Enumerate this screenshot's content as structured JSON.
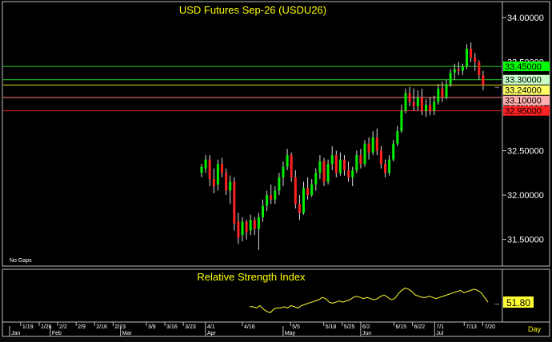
{
  "chart_data": [
    {
      "type": "candlestick",
      "title": "USD Futures Sep-26 (USDU26)",
      "note": "No Gaps",
      "ylim": [
        31.2,
        34.18
      ],
      "y_ticks": [
        "34.00000",
        "33.50000",
        "33.00000",
        "32.50000",
        "32.00000",
        "31.50000"
      ],
      "y_tick_values": [
        34.0,
        33.5,
        33.0,
        32.5,
        32.0,
        31.5
      ],
      "levels": [
        {
          "label": "33.45000",
          "value": 33.45,
          "color": "#22cc22",
          "box": "#00ff00",
          "text": "#000000"
        },
        {
          "label": "33.30000",
          "value": 33.3,
          "color": "#22cc22",
          "box": "#c8ffc8",
          "text": "#000000"
        },
        {
          "label": "33.24000",
          "value": 33.24,
          "color": "#dddd00",
          "box": "#ffff66",
          "text": "#000000"
        },
        {
          "label": "33.10000",
          "value": 33.1,
          "color": "#ff8080",
          "box": "#ffb0b0",
          "text": "#000000"
        },
        {
          "label": "32.95000",
          "value": 32.95,
          "color": "#dd2222",
          "box": "#ff2222",
          "text": "#000000"
        }
      ],
      "candles": [
        [
          32.25,
          32.35,
          32.2,
          32.32
        ],
        [
          32.3,
          32.45,
          32.25,
          32.4
        ],
        [
          32.4,
          32.45,
          32.1,
          32.18
        ],
        [
          32.18,
          32.3,
          32.02,
          32.1
        ],
        [
          32.12,
          32.4,
          32.05,
          32.35
        ],
        [
          32.35,
          32.42,
          32.2,
          32.25
        ],
        [
          32.25,
          32.3,
          32.0,
          32.05
        ],
        [
          32.05,
          32.22,
          31.9,
          32.15
        ],
        [
          32.15,
          32.2,
          31.6,
          31.68
        ],
        [
          31.7,
          31.8,
          31.45,
          31.52
        ],
        [
          31.55,
          31.75,
          31.48,
          31.7
        ],
        [
          31.7,
          31.72,
          31.5,
          31.58
        ],
        [
          31.6,
          31.78,
          31.55,
          31.72
        ],
        [
          31.72,
          31.75,
          31.55,
          31.62
        ],
        [
          31.62,
          31.8,
          31.38,
          31.75
        ],
        [
          31.75,
          31.95,
          31.7,
          31.88
        ],
        [
          31.88,
          32.05,
          31.82,
          32.0
        ],
        [
          32.0,
          32.12,
          31.9,
          31.95
        ],
        [
          31.95,
          32.1,
          31.9,
          32.05
        ],
        [
          32.05,
          32.25,
          32.0,
          32.2
        ],
        [
          32.2,
          32.38,
          32.1,
          32.32
        ],
        [
          32.32,
          32.52,
          32.28,
          32.45
        ],
        [
          32.45,
          32.48,
          32.15,
          32.2
        ],
        [
          32.2,
          32.28,
          31.85,
          31.9
        ],
        [
          31.9,
          32.0,
          31.72,
          31.8
        ],
        [
          31.8,
          32.15,
          31.78,
          32.08
        ],
        [
          32.08,
          32.2,
          31.95,
          32.0
        ],
        [
          32.0,
          32.18,
          31.98,
          32.12
        ],
        [
          32.12,
          32.3,
          32.05,
          32.25
        ],
        [
          32.25,
          32.45,
          32.18,
          32.38
        ],
        [
          32.38,
          32.42,
          32.1,
          32.15
        ],
        [
          32.15,
          32.4,
          32.12,
          32.35
        ],
        [
          32.35,
          32.55,
          32.28,
          32.45
        ],
        [
          32.45,
          32.5,
          32.2,
          32.25
        ],
        [
          32.25,
          32.48,
          32.22,
          32.4
        ],
        [
          32.4,
          32.45,
          32.22,
          32.28
        ],
        [
          32.28,
          32.38,
          32.15,
          32.2
        ],
        [
          32.2,
          32.32,
          32.1,
          32.28
        ],
        [
          32.28,
          32.5,
          32.25,
          32.45
        ],
        [
          32.45,
          32.52,
          32.3,
          32.35
        ],
        [
          32.35,
          32.62,
          32.32,
          32.58
        ],
        [
          32.58,
          32.65,
          32.4,
          32.48
        ],
        [
          32.48,
          32.72,
          32.45,
          32.65
        ],
        [
          32.65,
          32.75,
          32.45,
          32.5
        ],
        [
          32.5,
          32.55,
          32.3,
          32.35
        ],
        [
          32.35,
          32.4,
          32.2,
          32.25
        ],
        [
          32.25,
          32.45,
          32.22,
          32.4
        ],
        [
          32.4,
          32.62,
          32.38,
          32.58
        ],
        [
          32.58,
          32.78,
          32.55,
          32.72
        ],
        [
          32.72,
          33.02,
          32.7,
          32.95
        ],
        [
          32.95,
          33.2,
          32.92,
          33.15
        ],
        [
          33.15,
          33.22,
          33.0,
          33.05
        ],
        [
          33.05,
          33.2,
          32.95,
          33.0
        ],
        [
          33.0,
          33.18,
          32.95,
          33.1
        ],
        [
          33.1,
          33.2,
          32.9,
          32.95
        ],
        [
          32.95,
          33.08,
          32.88,
          33.02
        ],
        [
          33.02,
          33.1,
          32.9,
          32.95
        ],
        [
          32.95,
          33.12,
          32.9,
          33.05
        ],
        [
          33.05,
          33.25,
          33.02,
          33.2
        ],
        [
          33.2,
          33.28,
          33.05,
          33.1
        ],
        [
          33.1,
          33.3,
          33.08,
          33.25
        ],
        [
          33.25,
          33.42,
          33.22,
          33.38
        ],
        [
          33.38,
          33.48,
          33.3,
          33.42
        ],
        [
          33.42,
          33.5,
          33.35,
          33.4
        ],
        [
          33.4,
          33.48,
          33.35,
          33.45
        ],
        [
          33.45,
          33.7,
          33.42,
          33.65
        ],
        [
          33.65,
          33.72,
          33.5,
          33.55
        ],
        [
          33.55,
          33.6,
          33.4,
          33.5
        ],
        [
          33.5,
          33.52,
          33.3,
          33.35
        ],
        [
          33.35,
          33.4,
          33.18,
          33.24
        ]
      ],
      "x_ticks": [
        {
          "label": "1/19",
          "i": -47
        },
        {
          "label": "1/26",
          "i": -42
        },
        {
          "label": "2/2",
          "i": -37
        },
        {
          "label": "2/9",
          "i": -32
        },
        {
          "label": "2/16",
          "i": -27
        },
        {
          "label": "2/23",
          "i": -22
        },
        {
          "label": "3/9",
          "i": -13
        },
        {
          "label": "3/16",
          "i": -8
        },
        {
          "label": "3/23",
          "i": -3
        },
        {
          "label": "4/1",
          "i": 3
        },
        {
          "label": "4/16",
          "i": 13
        },
        {
          "label": "5/5",
          "i": 26
        },
        {
          "label": "5/18",
          "i": 35
        },
        {
          "label": "5/25",
          "i": 40
        },
        {
          "label": "6/2",
          "i": 45
        },
        {
          "label": "6/15",
          "i": 54
        },
        {
          "label": "6/22",
          "i": 59
        },
        {
          "label": "7/1",
          "i": 65
        },
        {
          "label": "7/13",
          "i": 73
        },
        {
          "label": "7/20",
          "i": 78
        }
      ],
      "months": [
        {
          "label": "Jan",
          "i": -50
        },
        {
          "label": "Feb",
          "i": -39
        },
        {
          "label": "Mar",
          "i": -20
        },
        {
          "label": "Apr",
          "i": 3
        },
        {
          "label": "May",
          "i": 24
        },
        {
          "label": "Jun",
          "i": 45
        },
        {
          "label": "Jul",
          "i": 65
        }
      ],
      "period_label": "Day"
    },
    {
      "type": "line",
      "title": "Relative Strength Index",
      "last_value": "51.80",
      "color": "#ffff33",
      "ylim": [
        35,
        80
      ],
      "values": [
        48,
        48,
        47,
        49,
        46,
        44,
        43,
        46,
        47,
        47,
        48,
        47,
        49,
        48,
        47,
        49,
        50,
        51,
        52,
        53,
        54,
        56,
        55,
        52,
        51,
        52,
        53,
        52,
        53,
        54,
        56,
        57,
        56,
        55,
        56,
        55,
        54,
        55,
        57,
        58,
        56,
        54,
        55,
        59,
        62,
        64,
        63,
        61,
        58,
        57,
        56,
        56,
        57,
        56,
        55,
        56,
        57,
        58,
        59,
        60,
        61,
        62,
        60,
        61,
        62,
        63,
        62,
        60,
        56,
        52
      ]
    }
  ]
}
